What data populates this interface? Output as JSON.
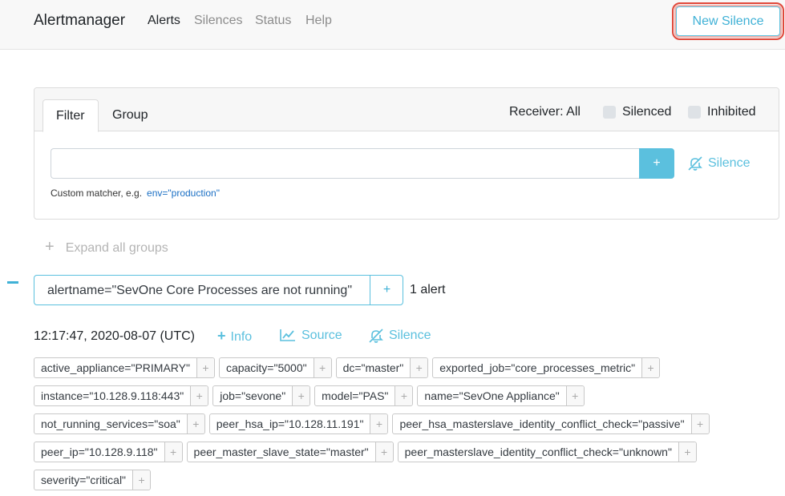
{
  "navbar": {
    "brand": "Alertmanager",
    "links": [
      "Alerts",
      "Silences",
      "Status",
      "Help"
    ],
    "active_link": "Alerts",
    "new_silence_label": "New Silence"
  },
  "filter": {
    "tabs": [
      "Filter",
      "Group"
    ],
    "active_tab": "Filter",
    "receiver_label": "Receiver: All",
    "silenced_label": "Silenced",
    "inhibited_label": "Inhibited",
    "input_value": "",
    "add_label": "+",
    "silence_label": "Silence",
    "hint_text": "Custom matcher, e.g.",
    "hint_example": "env=\"production\""
  },
  "expand_all_label": "Expand all groups",
  "group": {
    "label": "alertname=\"SevOne Core Processes are not running\"",
    "add_label": "+",
    "count": "1 alert"
  },
  "alert": {
    "timestamp": "12:17:47, 2020-08-07 (UTC)",
    "info_label": "Info",
    "source_label": "Source",
    "silence_label": "Silence",
    "labels": [
      [
        "active_appliance=\"PRIMARY\"",
        "capacity=\"5000\"",
        "dc=\"master\"",
        "exported_job=\"core_processes_metric\""
      ],
      [
        "instance=\"10.128.9.118:443\"",
        "job=\"sevone\"",
        "model=\"PAS\"",
        "name=\"SevOne Appliance\""
      ],
      [
        "not_running_services=\"soa\"",
        "peer_hsa_ip=\"10.128.11.191\"",
        "peer_hsa_masterslave_identity_conflict_check=\"passive\""
      ],
      [
        "peer_ip=\"10.128.9.118\"",
        "peer_master_slave_state=\"master\"",
        "peer_masterslave_identity_conflict_check=\"unknown\""
      ],
      [
        "severity=\"critical\""
      ]
    ],
    "label_add": "+"
  },
  "colors": {
    "accent": "#5bc0de",
    "highlight_ring": "#e0483a",
    "navbar_bg": "#f8f8f8"
  }
}
